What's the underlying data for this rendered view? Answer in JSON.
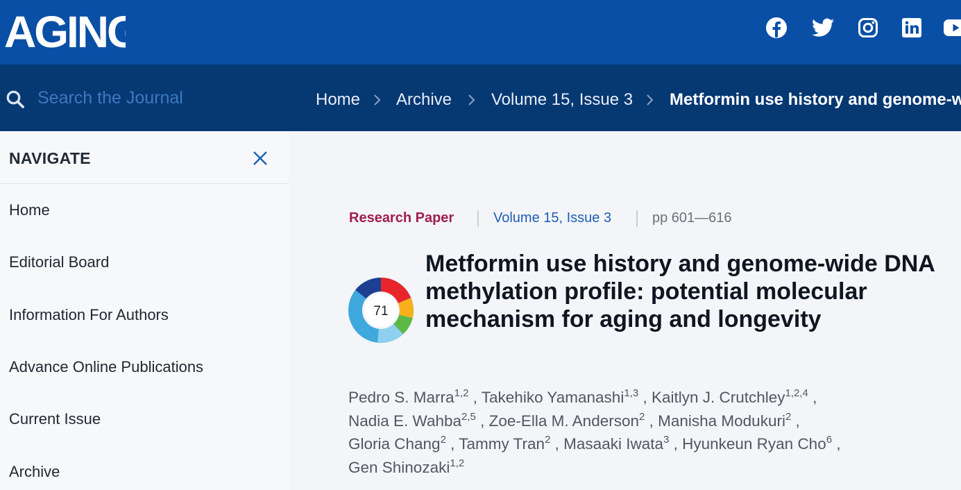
{
  "header": {
    "logo_text": "AGING",
    "social": [
      "facebook-icon",
      "twitter-icon",
      "instagram-icon",
      "linkedin-icon",
      "youtube-icon"
    ],
    "colors": {
      "topbar": "#0a4fa6",
      "navbar": "#063872"
    }
  },
  "search": {
    "placeholder": "Search the Journal"
  },
  "breadcrumb": {
    "home": "Home",
    "archive": "Archive",
    "volume": "Volume 15, Issue 3",
    "current": "Metformin use history and genome-wide DNA methylation profile: potential molecular mechanism for aging and longevity"
  },
  "sidebar": {
    "title": "NAVIGATE",
    "items": [
      "Home",
      "Editorial Board",
      "Information For Authors",
      "Advance Online Publications",
      "Current Issue",
      "Archive"
    ]
  },
  "article": {
    "type": "Research Paper",
    "volume": "Volume 15, Issue 3",
    "pages": "pp 601—616",
    "altmetric_score": "71",
    "title": "Metformin use history and genome-wide DNA methylation profile: potential molecular mechanism for aging and longevity",
    "authors": [
      {
        "name": "Pedro S. Marra",
        "aff": "1,2"
      },
      {
        "name": "Takehiko Yamanashi",
        "aff": "1,3"
      },
      {
        "name": "Kaitlyn J. Crutchley",
        "aff": "1,2,4"
      },
      {
        "name": "Nadia E. Wahba",
        "aff": "2,5"
      },
      {
        "name": "Zoe-Ella M. Anderson",
        "aff": "2"
      },
      {
        "name": "Manisha Modukuri",
        "aff": "2"
      },
      {
        "name": "Gloria Chang",
        "aff": "2"
      },
      {
        "name": "Tammy Tran",
        "aff": "2"
      },
      {
        "name": "Masaaki Iwata",
        "aff": "3"
      },
      {
        "name": "Hyunkeun Ryan Cho",
        "aff": "6"
      },
      {
        "name": "Gen Shinozaki",
        "aff": "1,2"
      }
    ],
    "colors": {
      "type": "#a11d4e",
      "volume": "#1c5fb5",
      "title": "#0f1620"
    }
  }
}
